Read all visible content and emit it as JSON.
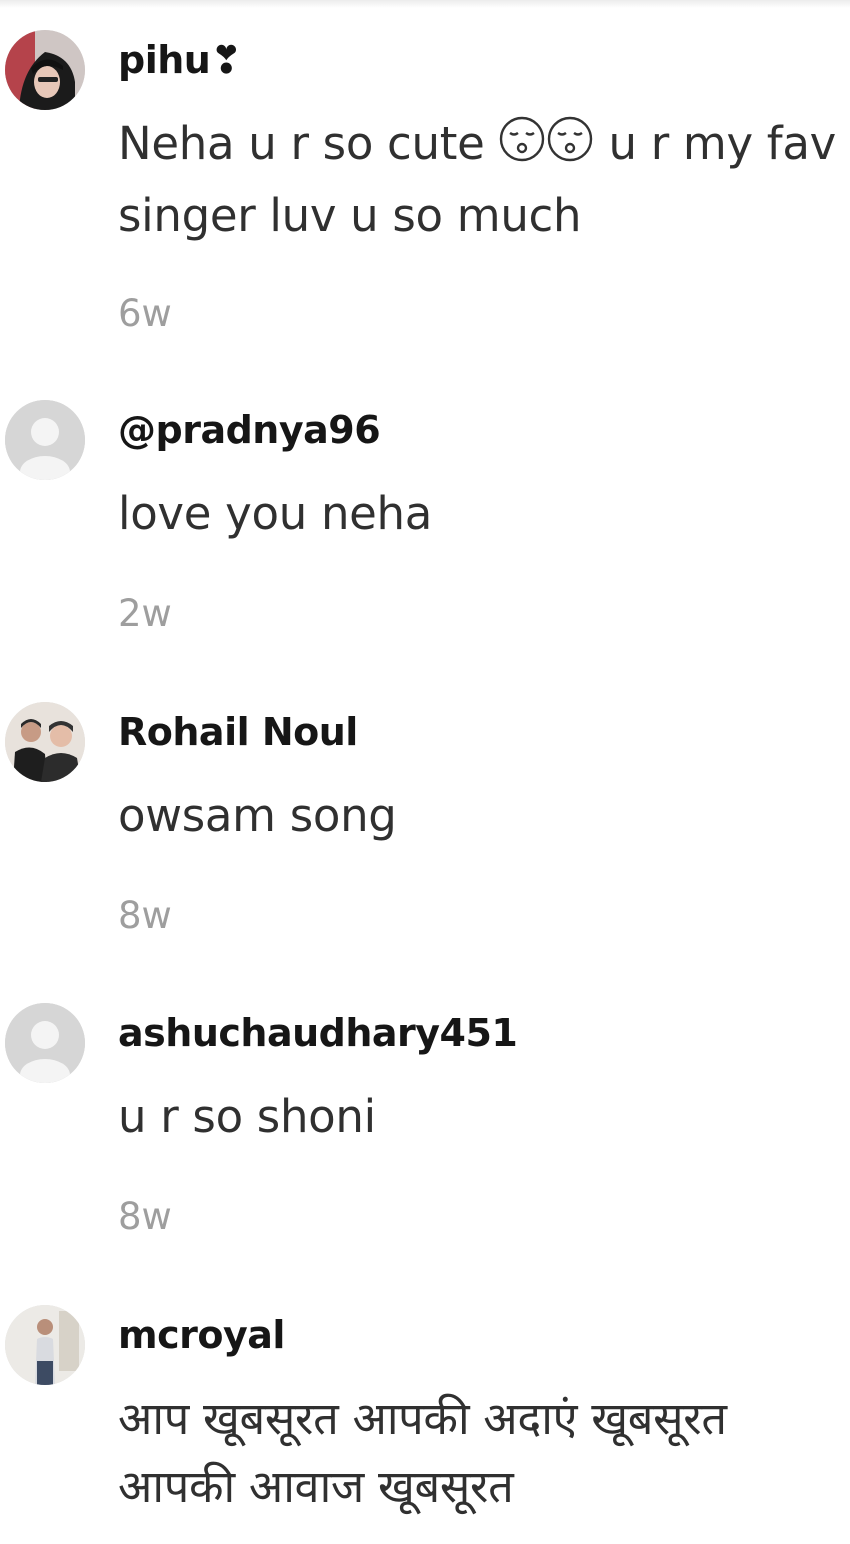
{
  "comments": [
    {
      "username": "pihu❣",
      "avatar_icon": "user-photo-avatar-icon",
      "text_before_emoji": "Neha u r so cute ",
      "emoji_icon": "kissing-face-emoji",
      "text_after_emoji": " u r my fav singer luv u so much",
      "time": "6w"
    },
    {
      "username": "@pradnya96",
      "avatar_icon": "default-avatar-icon",
      "text": "love you neha",
      "time": "2w"
    },
    {
      "username": "Rohail Noul",
      "avatar_icon": "user-photo-avatar-icon",
      "text": "owsam song",
      "time": "8w"
    },
    {
      "username": "ashuchaudhary451",
      "avatar_icon": "default-avatar-icon",
      "text": "u r so shoni",
      "time": "8w"
    },
    {
      "username": "mcroyal",
      "avatar_icon": "user-photo-avatar-icon",
      "text": "आप खूबसूरत आपकी अदाएं खूबसूरत आपकी आवाज खूबसूरत"
    }
  ]
}
